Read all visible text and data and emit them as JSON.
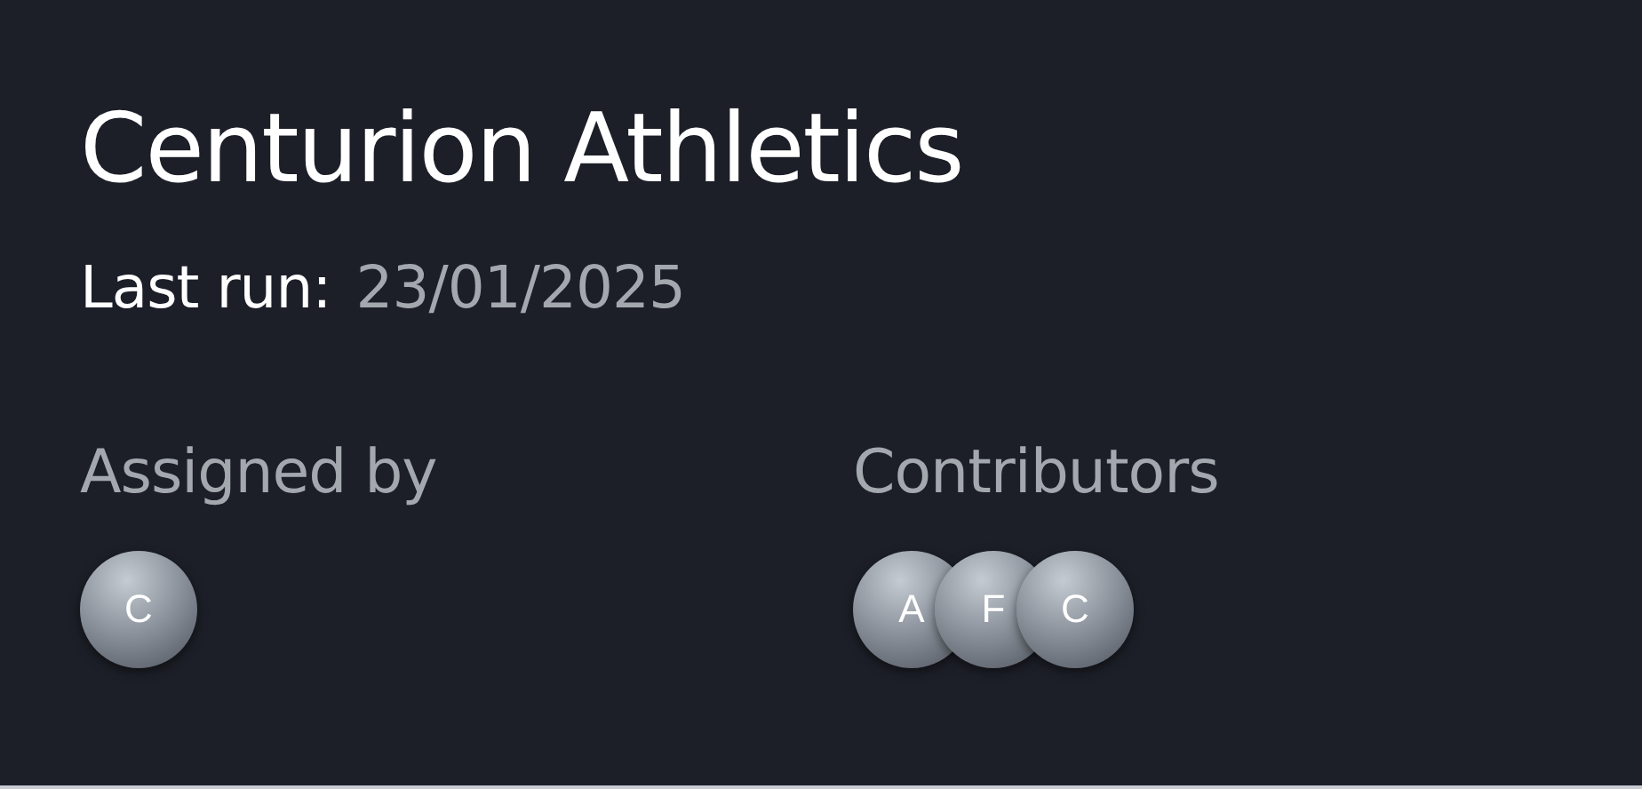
{
  "title": "Centurion Athletics",
  "last_run": {
    "label": "Last run:",
    "value": "23/01/2025"
  },
  "assigned_by": {
    "label": "Assigned by",
    "avatars": [
      {
        "initial": "C"
      }
    ]
  },
  "contributors": {
    "label": "Contributors",
    "avatars": [
      {
        "initial": "A"
      },
      {
        "initial": "F"
      },
      {
        "initial": "C"
      }
    ]
  }
}
